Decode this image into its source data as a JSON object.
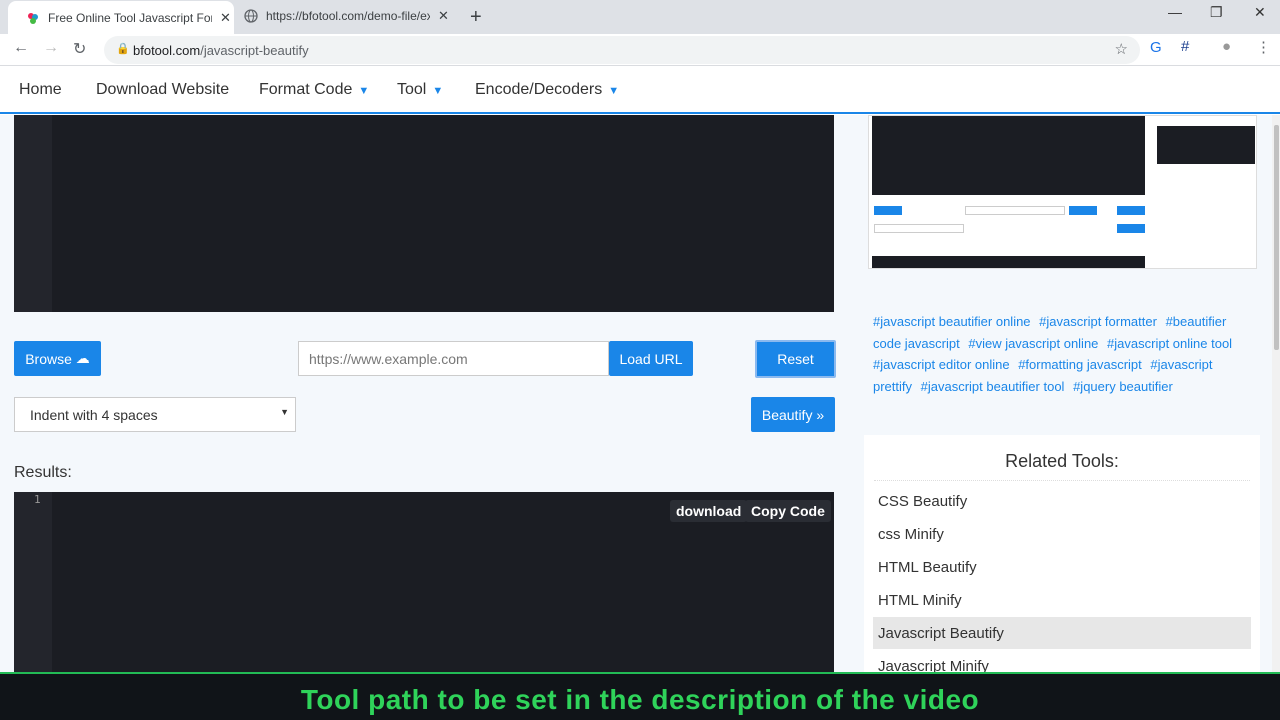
{
  "browser": {
    "tabs": [
      {
        "title": "Free Online Tool Javascript Format",
        "active": true
      },
      {
        "title": "https://bfotool.com/demo-file/ex",
        "active": false
      }
    ],
    "new_tab_symbol": "+",
    "url_domain": "bfotool.com",
    "url_path": "/javascript-beautify",
    "window_controls": [
      "—",
      "❐",
      "✕"
    ]
  },
  "nav": {
    "items": [
      {
        "label": "Home",
        "has_caret": false
      },
      {
        "label": "Download Website",
        "has_caret": false
      },
      {
        "label": "Format Code",
        "has_caret": true
      },
      {
        "label": "Tool",
        "has_caret": true
      },
      {
        "label": "Encode/Decoders",
        "has_caret": true
      }
    ]
  },
  "controls": {
    "browse_label": "Browse",
    "url_placeholder": "https://www.example.com",
    "load_url_label": "Load URL",
    "reset_label": "Reset",
    "indent_option": "Indent with 4 spaces",
    "beautify_label": "Beautify"
  },
  "results": {
    "label": "Results:",
    "line_number": "1",
    "download_label": "download",
    "copy_label": "Copy Code"
  },
  "tags": [
    "#javascript beautifier online",
    "#javascript formatter",
    "#beautifier code javascript",
    "#view javascript online",
    "#javascript online tool",
    "#javascript editor online",
    "#formatting javascript",
    "#javascript prettify",
    "#javascript beautifier tool",
    "#jquery beautifier"
  ],
  "related": {
    "title": "Related Tools:",
    "items": [
      {
        "label": "CSS Beautify",
        "active": false
      },
      {
        "label": "css Minify",
        "active": false
      },
      {
        "label": "HTML Beautify",
        "active": false
      },
      {
        "label": "HTML Minify",
        "active": false
      },
      {
        "label": "Javascript Beautify",
        "active": true
      },
      {
        "label": "Javascript Minify",
        "active": false
      }
    ]
  },
  "caption": "Tool path to be set in the description of the video",
  "colors": {
    "accent": "#1a86e8",
    "editor_bg": "#1b1d23",
    "caption_text": "#2fd35a"
  }
}
